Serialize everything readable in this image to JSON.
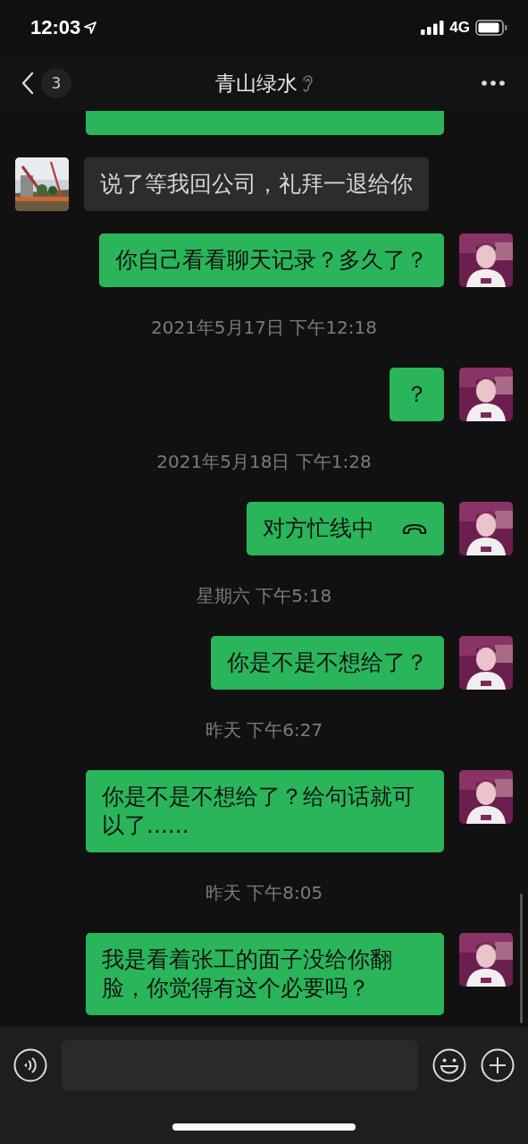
{
  "status_bar": {
    "time": "12:03",
    "network": "4G"
  },
  "header": {
    "back_count": "3",
    "title": "青山绿水"
  },
  "messages": [
    {
      "kind": "cut",
      "outgoing": true
    },
    {
      "kind": "text",
      "outgoing": false,
      "text": "说了等我回公司，礼拜一退给你"
    },
    {
      "kind": "text",
      "outgoing": true,
      "text": "你自己看看聊天记录？多久了？"
    },
    {
      "kind": "time",
      "text": "2021年5月17日 下午12:18"
    },
    {
      "kind": "text",
      "outgoing": true,
      "text": "？"
    },
    {
      "kind": "time",
      "text": "2021年5月18日 下午1:28"
    },
    {
      "kind": "call",
      "outgoing": true,
      "text": "对方忙线中"
    },
    {
      "kind": "time",
      "text": "星期六 下午5:18"
    },
    {
      "kind": "text",
      "outgoing": true,
      "text": "你是不是不想给了？"
    },
    {
      "kind": "time",
      "text": "昨天 下午6:27"
    },
    {
      "kind": "text",
      "outgoing": true,
      "text": "你是不是不想给了？给句话就可以了......"
    },
    {
      "kind": "time",
      "text": "昨天 下午8:05"
    },
    {
      "kind": "text",
      "outgoing": true,
      "text": "我是看着张工的面子没给你翻脸，你觉得有这个必要吗？"
    }
  ]
}
